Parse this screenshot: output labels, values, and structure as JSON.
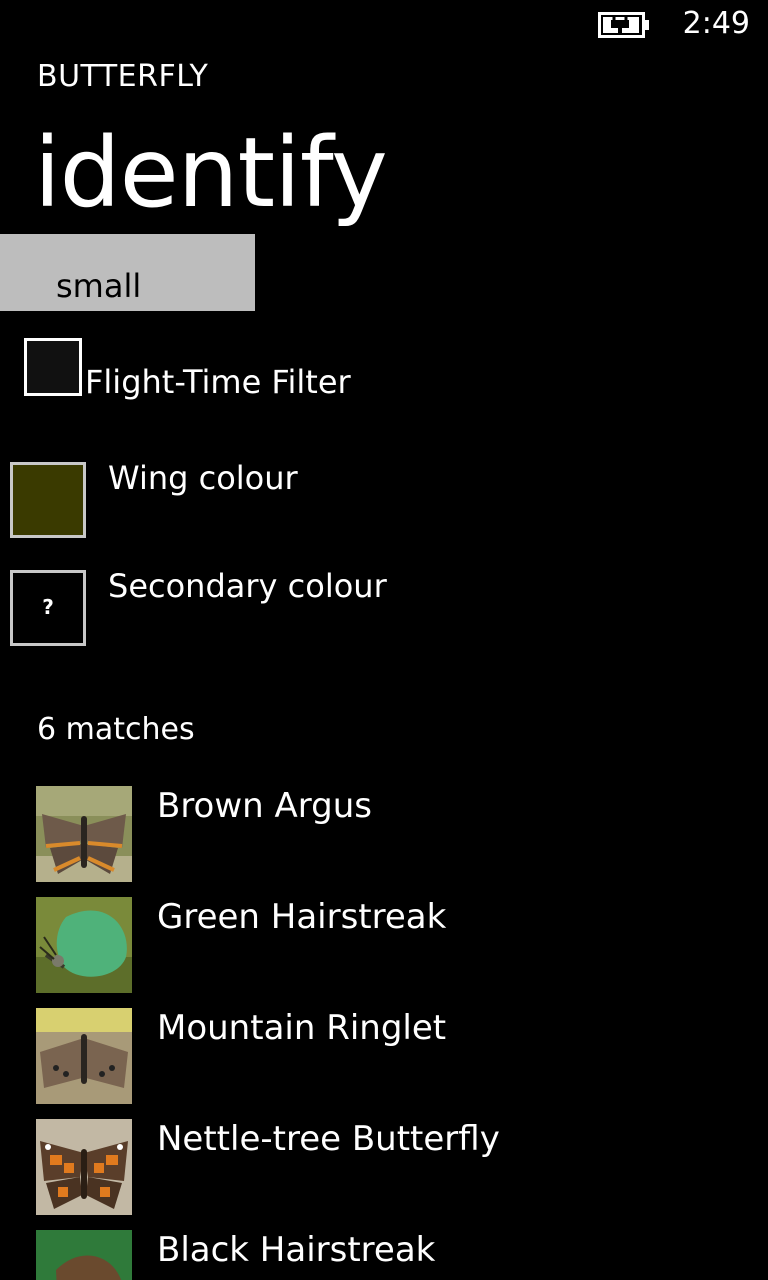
{
  "status_bar": {
    "time": "2:49",
    "battery_icon": "battery-charging-icon"
  },
  "header": {
    "app_name": "BUTTERFLY",
    "page_title": "identify"
  },
  "size_picker": {
    "selected": "small"
  },
  "flight_time_filter": {
    "label": "Flight-Time Filter",
    "checked": false
  },
  "wing_colour": {
    "label": "Wing colour",
    "color": "#3a3a00"
  },
  "secondary_colour": {
    "label": "Secondary colour",
    "symbol": "?"
  },
  "results": {
    "count_label": "6 matches",
    "items": [
      {
        "name": "Brown Argus"
      },
      {
        "name": "Green Hairstreak"
      },
      {
        "name": "Mountain Ringlet"
      },
      {
        "name": "Nettle-tree Butterfly"
      },
      {
        "name": "Black Hairstreak"
      }
    ]
  }
}
